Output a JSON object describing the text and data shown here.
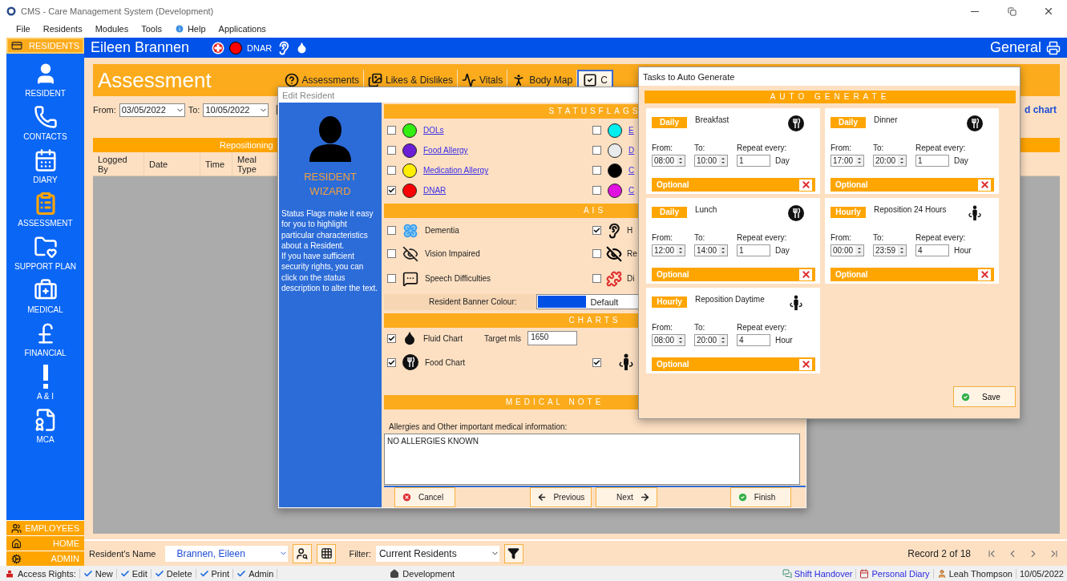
{
  "window": {
    "title": "CMS - Care Management System (Development)"
  },
  "menu": [
    "File",
    "Residents",
    "Modules",
    "Tools",
    "Help",
    "Applications"
  ],
  "sidebar": {
    "header": "RESIDENTS",
    "items": [
      {
        "label": "RESIDENT",
        "selected": false
      },
      {
        "label": "CONTACTS",
        "selected": false
      },
      {
        "label": "DIARY",
        "selected": false
      },
      {
        "label": "ASSESSMENT",
        "selected": true
      },
      {
        "label": "SUPPORT PLAN",
        "selected": false
      },
      {
        "label": "MEDICAL",
        "selected": false
      },
      {
        "label": "FINANCIAL",
        "selected": false
      },
      {
        "label": "A & I",
        "selected": false
      },
      {
        "label": "MCA",
        "selected": false
      }
    ],
    "footer": [
      "EMPLOYEES",
      "HOME",
      "ADMIN"
    ]
  },
  "banner": {
    "name": "Eileen Brannen",
    "flag": "DNAR",
    "section": "General"
  },
  "page": {
    "title": "Assessment",
    "tabs": [
      {
        "label": "Assessments",
        "selected": false
      },
      {
        "label": "Likes & Dislikes",
        "selected": false
      },
      {
        "label": "Vitals",
        "selected": false
      },
      {
        "label": "Body Map",
        "selected": false
      },
      {
        "label": "C",
        "selected": true
      }
    ],
    "from_label": "From:",
    "from": "03/05/2022",
    "to_label": "To:",
    "to": "10/05/2022",
    "link": "d chart",
    "table": {
      "group": "Repositioning",
      "columns": [
        "Logged By",
        "Date",
        "Time",
        "Meal Type"
      ]
    }
  },
  "footer": {
    "name_label": "Resident's Name",
    "name": "Brannen, Eileen",
    "filter_label": "Filter:",
    "filter": "Current Residents",
    "record": "Record 2 of 18"
  },
  "status_bar": {
    "access_label": "Access Rights:",
    "rights": [
      "New",
      "Edit",
      "Delete",
      "Print",
      "Admin"
    ],
    "environment": "Development",
    "links": [
      "Shift Handover",
      "Personal Diary"
    ],
    "user": "Leah Thompson",
    "date": "10/05/2022"
  },
  "edit_dialog": {
    "title": "Edit Resident",
    "wizard_title": "RESIDENT WIZARD",
    "help": [
      "Status Flags make it easy for you to highlight particular characteristics about a Resident.",
      "If you have sufficient security rights, you can click on the status description to alter the text."
    ],
    "status_header": "STATUSFLAGS",
    "flags_left": [
      {
        "label": "DOLs",
        "color": "#33ee11",
        "checked": false
      },
      {
        "label": "Food Allergy",
        "color": "#6a1fd6",
        "checked": false
      },
      {
        "label": "Medication Allergy",
        "color": "#ffee00",
        "checked": false
      },
      {
        "label": "DNAR",
        "color": "#ff0000",
        "checked": true
      }
    ],
    "flags_right": [
      {
        "label": "E",
        "color": "#00eeee",
        "checked": false
      },
      {
        "label": "D",
        "color": "#e8eaec",
        "checked": false
      },
      {
        "label": "C",
        "color": "#000000",
        "checked": false
      },
      {
        "label": "C",
        "color": "#e010e0",
        "checked": false
      }
    ],
    "ais_header": "AIS",
    "ais_left": [
      {
        "label": "Dementia",
        "checked": false
      },
      {
        "label": "Vision Impaired",
        "checked": false
      },
      {
        "label": "Speech Difficulties",
        "checked": false
      }
    ],
    "ais_right": [
      {
        "label": "H",
        "checked": true
      },
      {
        "label": "Re",
        "checked": false
      },
      {
        "label": "Di",
        "checked": false
      }
    ],
    "banner_label": "Resident Banner Colour:",
    "banner_value": "Default",
    "charts_header": "CHARTS",
    "charts": [
      {
        "label": "Fluid Chart",
        "checked": true,
        "kind": "fluid",
        "target_label": "Target mls",
        "target": "1650"
      },
      {
        "label": "Food Chart",
        "checked": true,
        "kind": "food"
      }
    ],
    "reposition_chart": {
      "checked": true
    },
    "notes_header": "MEDICAL NOTE",
    "notes_label": "Allergies and Other important medical information:",
    "notes": "NO ALLERGIES KNOWN",
    "buttons": [
      {
        "label": "Cancel",
        "kind": "cancel"
      },
      {
        "label": "Previous",
        "kind": "previous"
      },
      {
        "label": "Next",
        "kind": "next"
      },
      {
        "label": "Finish",
        "kind": "finish"
      }
    ]
  },
  "tasks_dialog": {
    "title": "Tasks to Auto Generate",
    "header": "AUTO GENERATE",
    "save": "Save",
    "cards": [
      {
        "frequency": "Daily",
        "name": "Breakfast",
        "kind": "meal",
        "from_label": "From:",
        "from": "08:00",
        "to_label": "To:",
        "to": "10:00",
        "repeat_label": "Repeat every:",
        "repeat": "1",
        "unit": "Day",
        "optional": "Optional"
      },
      {
        "frequency": "Daily",
        "name": "Dinner",
        "kind": "meal",
        "from_label": "From:",
        "from": "17:00",
        "to_label": "To:",
        "to": "20:00",
        "repeat_label": "Repeat every:",
        "repeat": "1",
        "unit": "Day",
        "optional": "Optional"
      },
      {
        "frequency": "Daily",
        "name": "Lunch",
        "kind": "meal",
        "from_label": "From:",
        "from": "12:00",
        "to_label": "To:",
        "to": "14:00",
        "repeat_label": "Repeat every:",
        "repeat": "1",
        "unit": "Day",
        "optional": "Optional"
      },
      {
        "frequency": "Hourly",
        "name": "Reposition 24 Hours",
        "kind": "reposition",
        "from_label": "From:",
        "from": "00:00",
        "to_label": "To:",
        "to": "23:59",
        "repeat_label": "Repeat every:",
        "repeat": "4",
        "unit": "Hour",
        "optional": "Optional"
      },
      {
        "frequency": "Hourly",
        "name": "Reposition Daytime",
        "kind": "reposition",
        "from_label": "From:",
        "from": "08:00",
        "to_label": "To:",
        "to": "20:00",
        "repeat_label": "Repeat every:",
        "repeat": "4",
        "unit": "Hour",
        "optional": "Optional"
      }
    ]
  }
}
